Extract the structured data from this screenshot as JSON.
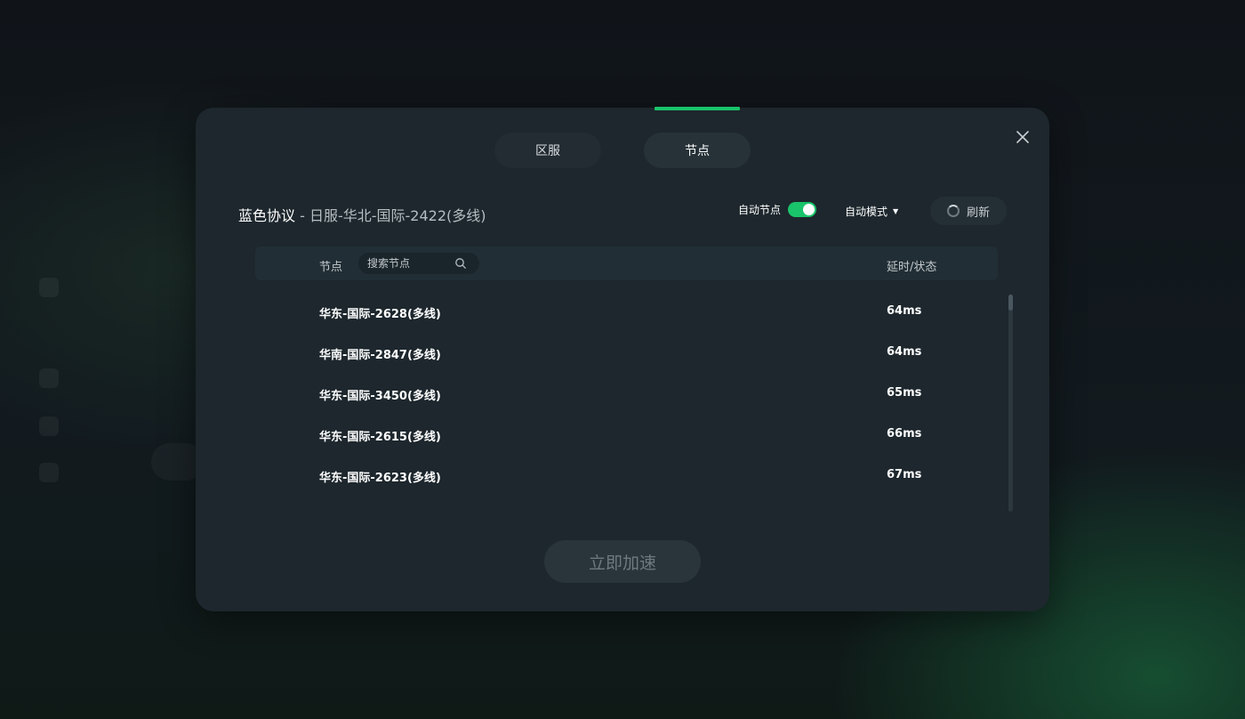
{
  "tabs": [
    {
      "label": "区服"
    },
    {
      "label": "节点"
    }
  ],
  "heading": {
    "game": "蓝色协议",
    "separator": " - ",
    "server": "日服-华北-国际-2422(多线)"
  },
  "controls": {
    "auto_node_label": "自动节点",
    "auto_node_on": true,
    "mode_label": "自动模式",
    "refresh_label": "刷新"
  },
  "table": {
    "col_node": "节点",
    "search_placeholder": "搜索节点",
    "col_latency": "延时/状态",
    "rows": [
      {
        "name": "华东-国际-2628(多线)",
        "latency": "64ms"
      },
      {
        "name": "华南-国际-2847(多线)",
        "latency": "64ms"
      },
      {
        "name": "华东-国际-3450(多线)",
        "latency": "65ms"
      },
      {
        "name": "华东-国际-2615(多线)",
        "latency": "66ms"
      },
      {
        "name": "华东-国际-2623(多线)",
        "latency": "67ms"
      }
    ]
  },
  "action": {
    "accelerate_label": "立即加速"
  },
  "colors": {
    "accent": "#19c46a",
    "modal_bg": "#1d272d"
  },
  "icons": {
    "close": "close-icon",
    "search": "search-icon",
    "refresh": "refresh-icon",
    "dropdown": "caret-down-icon"
  }
}
